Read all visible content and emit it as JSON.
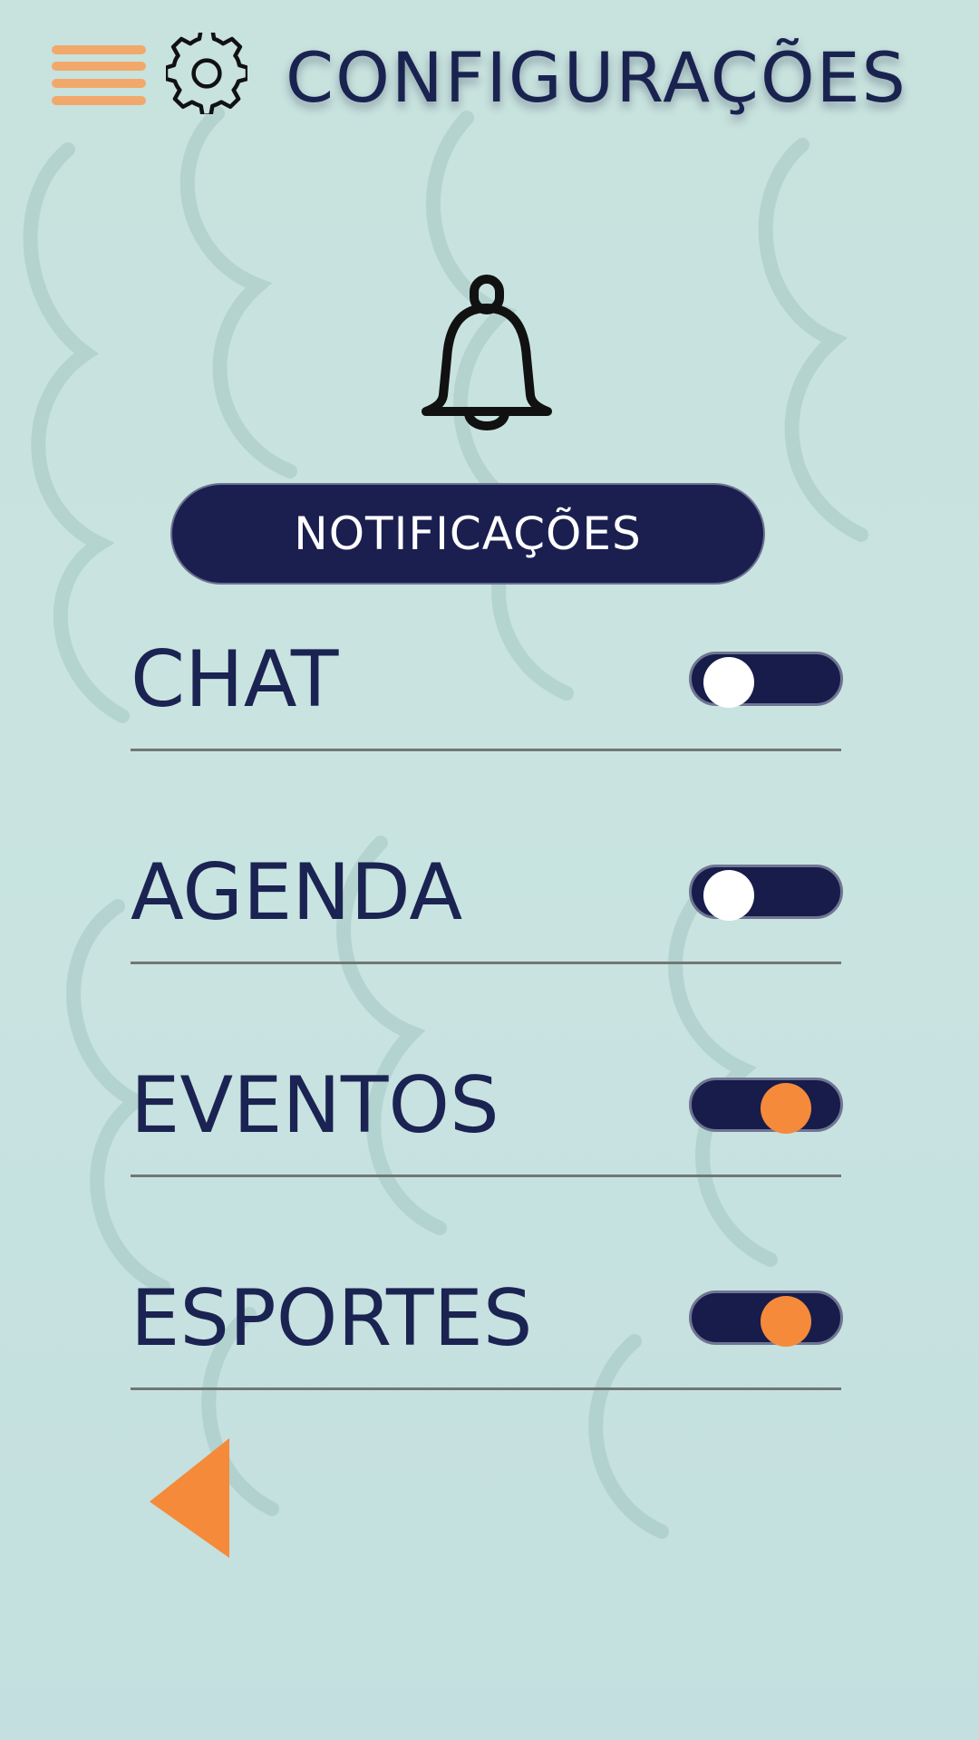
{
  "app": {
    "title": "CONFIGURAÇÕES"
  },
  "header": {
    "menu_icon": "hamburger-menu-icon",
    "settings_icon": "gear-icon"
  },
  "section": {
    "icon": "bell-icon",
    "title": "NOTIFICAÇÕES"
  },
  "settings": [
    {
      "label": "CHAT",
      "enabled": false
    },
    {
      "label": "AGENDA",
      "enabled": false
    },
    {
      "label": "EVENTOS",
      "enabled": true
    },
    {
      "label": "ESPORTES",
      "enabled": true
    }
  ],
  "navigation": {
    "back_icon": "back-arrow-icon"
  },
  "colors": {
    "background": "#c8e2de",
    "navy": "#1a1f4f",
    "accent_orange": "#f58a3a",
    "menu_orange": "#f2a86b",
    "text": "#1b2352",
    "divider": "#717775"
  }
}
